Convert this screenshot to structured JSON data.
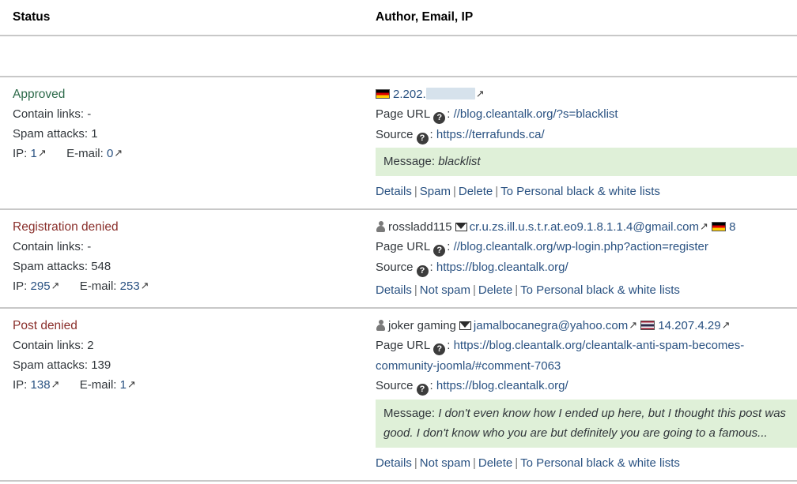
{
  "table": {
    "headers": {
      "status": "Status",
      "author": "Author, Email, IP"
    },
    "labels": {
      "contain_links": "Contain links:",
      "spam_attacks": "Spam attacks:",
      "ip": "IP:",
      "email": "E-mail:",
      "page_url": "Page URL",
      "source": "Source",
      "message": "Message:",
      "colon": ":",
      "help_icon_glyph": "?",
      "external_link_icon": "↗"
    },
    "rows": [
      {
        "status": "Approved",
        "status_kind": "approved",
        "contain_links": "-",
        "spam_attacks": "1",
        "ip_count": "1",
        "email_count": "0",
        "author_name": "",
        "email": "",
        "has_author": false,
        "flag": "de",
        "ip": "2.202.",
        "ip_redacted": true,
        "page_url": "//blog.cleantalk.org/?s=blacklist",
        "source_url": "https://terrafunds.ca/",
        "message": "blacklist",
        "has_message": true,
        "actions": [
          "Details",
          "Spam",
          "Delete",
          "To Personal black & white lists"
        ]
      },
      {
        "status": "Registration denied",
        "status_kind": "denied",
        "contain_links": "-",
        "spam_attacks": "548",
        "ip_count": "295",
        "email_count": "253",
        "author_name": "rossladd115",
        "email": "cr.u.zs.ill.u.s.t.r.at.eo9.1.8.1.1.4@gmail.com",
        "has_author": true,
        "flag": "de",
        "ip": "8",
        "ip_redacted": false,
        "page_url": "//blog.cleantalk.org/wp-login.php?action=register",
        "source_url": "https://blog.cleantalk.org/",
        "message": "",
        "has_message": false,
        "actions": [
          "Details",
          "Not spam",
          "Delete",
          "To Personal black & white lists"
        ]
      },
      {
        "status": "Post denied",
        "status_kind": "denied",
        "contain_links": "2",
        "spam_attacks": "139",
        "ip_count": "138",
        "email_count": "1",
        "author_name": "joker gaming",
        "email": "jamalbocanegra@yahoo.com",
        "has_author": true,
        "flag": "th",
        "ip": "14.207.4.29",
        "ip_redacted": false,
        "page_url": "https://blog.cleantalk.org/cleantalk-anti-spam-becomes-community-joomla/#comment-7063",
        "source_url": "https://blog.cleantalk.org/",
        "message": "I don't even know how I ended up here, but I thought this post was good. I don't know who you are but definitely you are going to a famous...",
        "has_message": true,
        "actions": [
          "Details",
          "Not spam",
          "Delete",
          "To Personal black & white lists"
        ]
      }
    ]
  },
  "colors": {
    "approved": "#2d6a4a",
    "denied": "#8a2f2b",
    "link": "#2a5282",
    "message_bg": "#dff0d8",
    "border": "#c8c8c8"
  }
}
